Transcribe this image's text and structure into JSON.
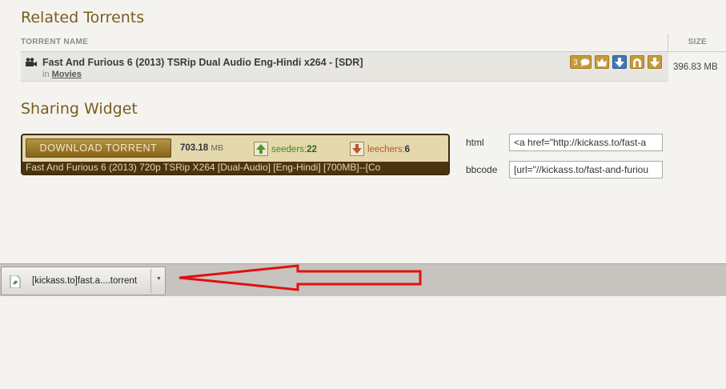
{
  "related": {
    "title": "Related Torrents",
    "col_name": "TORRENT NAME",
    "col_size": "SIZE",
    "row": {
      "name": "Fast And Furious 6 (2013) TSRip Dual Audio Eng-Hindi x264 - [SDR]",
      "in": "in",
      "category": "Movies",
      "comments": "3",
      "size": "396.83 MB",
      "icons": [
        "comment-icon",
        "crown-icon",
        "download-icon",
        "magnet-icon",
        "download-torrent-icon"
      ]
    }
  },
  "sharing": {
    "title": "Sharing Widget",
    "download_label": "DOWNLOAD TORRENT",
    "size_value": "703.18",
    "size_unit": "MB",
    "seeders_label": "seeders:",
    "seeders_count": "22",
    "leechers_label": "leechers:",
    "leechers_count": "6",
    "torrent_title": "Fast And Furious 6 (2013) 720p TSRip X264 [Dual-Audio] [Eng-Hindi] [700MB]--[Co",
    "html_label": "html",
    "html_value": "<a href=\"http://kickass.to/fast-a",
    "bbcode_label": "bbcode",
    "bbcode_value": "[url=\"//kickass.to/fast-and-furiou"
  },
  "download_bar": {
    "file_name": "[kickass.to]fast.a....torrent"
  },
  "colors": {
    "accent": "#7a5c1e",
    "widget_bg": "#e5d8ad",
    "widget_dark": "#4a3410",
    "arrow_red": "#e01010"
  }
}
